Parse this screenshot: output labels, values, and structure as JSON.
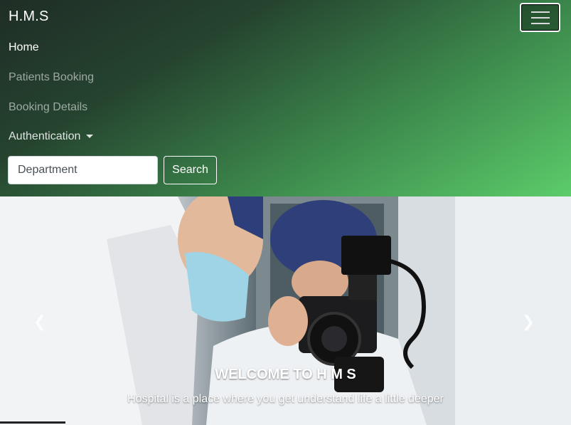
{
  "navbar": {
    "brand": "H.M.S",
    "toggler_icon": "hamburger-icon",
    "items": [
      {
        "label": "Home",
        "active": true
      },
      {
        "label": "Patients Booking",
        "active": false
      },
      {
        "label": "Booking Details",
        "active": false
      },
      {
        "label": "Authentication",
        "dropdown": true
      }
    ],
    "search": {
      "placeholder": "Department",
      "value": "",
      "button_label": "Search"
    }
  },
  "carousel": {
    "title": "WELCOME TO H M S",
    "subtitle": "Hospital is a place where you get understand life a little deeper",
    "prev_icon": "chevron-left-icon",
    "next_icon": "chevron-right-icon"
  },
  "colors": {
    "gradient_start": "#1f2e26",
    "gradient_end": "#5ccc6a",
    "text_light": "#ffffff"
  }
}
